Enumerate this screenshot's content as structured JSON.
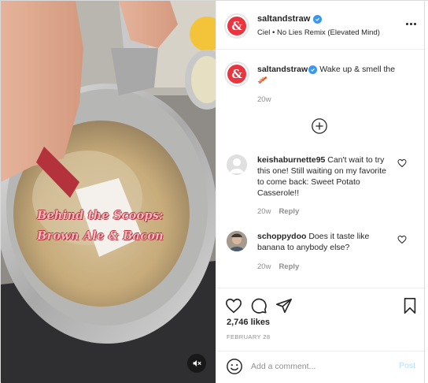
{
  "media": {
    "overlay_line1": "Behind the Scoops:",
    "overlay_line2": "Brown Ale & Bacon",
    "mute_icon": "speaker-muted-icon"
  },
  "header": {
    "username": "saltandstraw",
    "verified": true,
    "audio": "Ciel • No Lies Remix (Elevated Mind)",
    "avatar_letter": "&",
    "brand_color": "#e8353f"
  },
  "caption": {
    "username": "saltandstraw",
    "text": "Wake up & smell the",
    "emoji": "🥓",
    "time": "20w"
  },
  "comments": [
    {
      "username": "keishaburnette95",
      "text": "Can't wait to try this one! Still waiting on my favorite to come back: Sweet Potato Casserole!!",
      "time": "20w",
      "reply": "Reply"
    },
    {
      "username": "schoppydoo",
      "text": "Does it taste like banana to anybody else?",
      "time": "20w",
      "reply": "Reply"
    }
  ],
  "actions": {
    "likes": "2,746 likes",
    "date": "FEBRUARY 28"
  },
  "add_comment": {
    "placeholder": "Add a comment...",
    "post_label": "Post"
  },
  "colors": {
    "verified": "#3897f0",
    "post_disabled": "#b2dffc",
    "muted_text": "#8e8e8e"
  }
}
